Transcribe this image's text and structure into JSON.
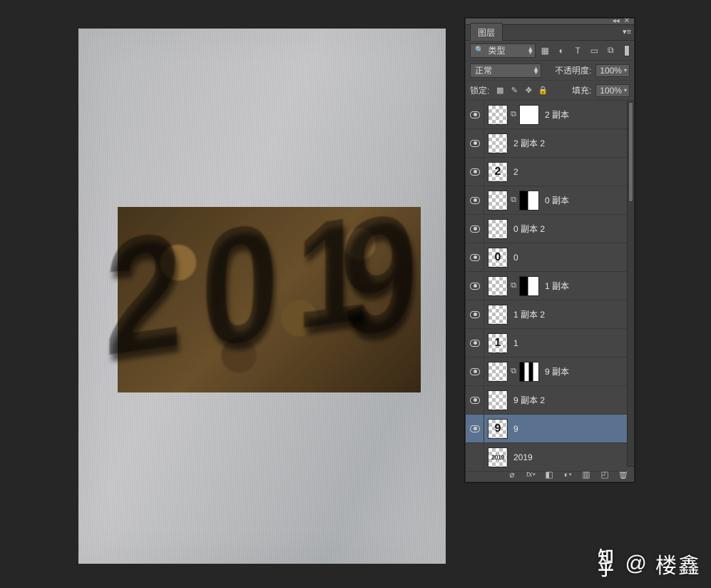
{
  "panel": {
    "tab": "图层",
    "filter_dropdown": "类型",
    "blend_mode": "正常",
    "opacity_label": "不透明度:",
    "opacity_value": "100%",
    "lock_label": "锁定:",
    "fill_label": "填充:",
    "fill_value": "100%"
  },
  "type_filter_icons": [
    "image-filter-icon",
    "adjustment-filter-icon",
    "type-filter-icon",
    "shape-filter-icon",
    "smartobject-filter-icon"
  ],
  "lock_icons": [
    "lock-pixels-icon",
    "lock-brush-icon",
    "lock-position-icon",
    "lock-all-icon"
  ],
  "layers": [
    {
      "name": "2 副本",
      "visible": true,
      "hasMask": true,
      "mask": "white",
      "glyph": "",
      "selected": false
    },
    {
      "name": "2 副本 2",
      "visible": true,
      "hasMask": false,
      "mask": "",
      "glyph": "",
      "selected": false
    },
    {
      "name": "2",
      "visible": true,
      "hasMask": false,
      "mask": "",
      "glyph": "2",
      "selected": false
    },
    {
      "name": "0 副本",
      "visible": true,
      "hasMask": true,
      "mask": "split",
      "glyph": "",
      "selected": false
    },
    {
      "name": "0 副本 2",
      "visible": true,
      "hasMask": false,
      "mask": "",
      "glyph": "",
      "selected": false
    },
    {
      "name": "0",
      "visible": true,
      "hasMask": false,
      "mask": "",
      "glyph": "0",
      "selected": false
    },
    {
      "name": "1 副本",
      "visible": true,
      "hasMask": true,
      "mask": "split",
      "glyph": "",
      "selected": false
    },
    {
      "name": "1 副本 2",
      "visible": true,
      "hasMask": false,
      "mask": "",
      "glyph": "",
      "selected": false
    },
    {
      "name": "1",
      "visible": true,
      "hasMask": false,
      "mask": "",
      "glyph": "1",
      "selected": false
    },
    {
      "name": "9 副本",
      "visible": true,
      "hasMask": true,
      "mask": "bars",
      "glyph": "",
      "selected": false
    },
    {
      "name": "9 副本 2",
      "visible": true,
      "hasMask": false,
      "mask": "",
      "glyph": "",
      "selected": false
    },
    {
      "name": "9",
      "visible": true,
      "hasMask": false,
      "mask": "",
      "glyph": "9",
      "selected": true
    },
    {
      "name": "2019",
      "visible": false,
      "hasMask": false,
      "mask": "",
      "glyph": "2019",
      "selected": false,
      "year": true
    }
  ],
  "footer_icons": [
    "link-icon",
    "fx-icon",
    "mask-icon",
    "adjustment-icon",
    "group-icon",
    "new-layer-icon",
    "trash-icon"
  ],
  "canvas_art_digits": [
    "2",
    "0",
    "1",
    "9"
  ],
  "watermark": {
    "site": "知乎",
    "at": "@",
    "author": "楼鑫"
  }
}
